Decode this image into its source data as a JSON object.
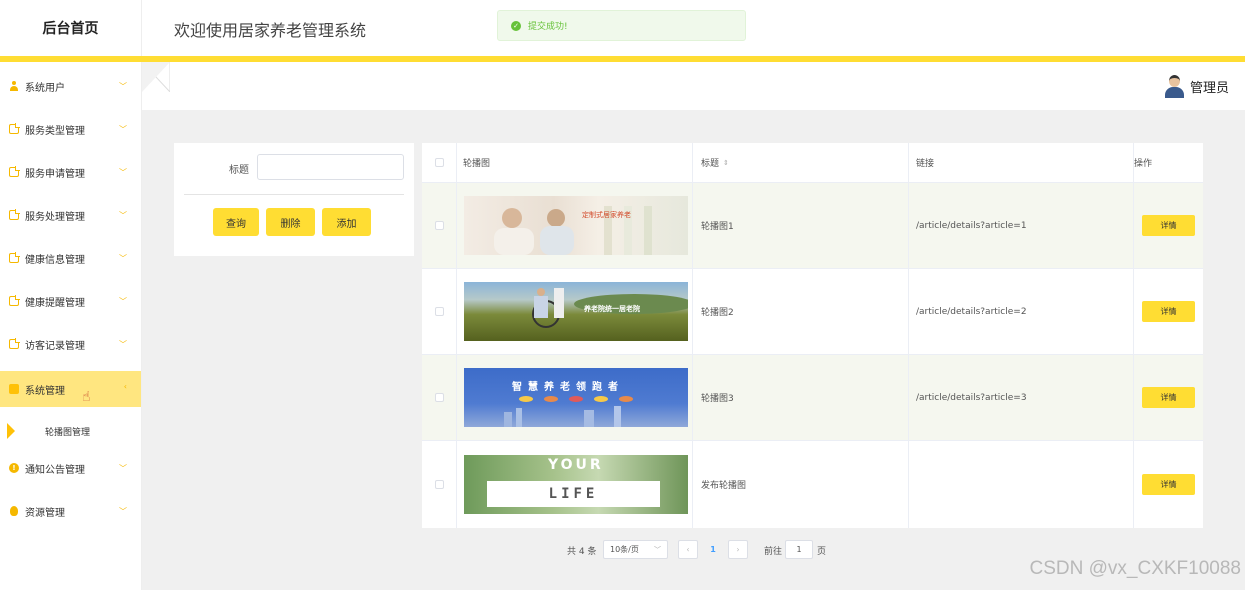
{
  "header": {
    "brand": "后台首页",
    "welcome": "欢迎使用居家养老管理系统",
    "toast": "提交成功!",
    "toast_icon": "check-circle-icon"
  },
  "user": {
    "name": "管理员",
    "avatar_icon": "avatar-icon"
  },
  "sidebar": {
    "items": [
      {
        "label": "系统用户",
        "icon": "user-icon"
      },
      {
        "label": "服务类型管理",
        "icon": "document-icon"
      },
      {
        "label": "服务申请管理",
        "icon": "document-icon"
      },
      {
        "label": "服务处理管理",
        "icon": "document-icon"
      },
      {
        "label": "健康信息管理",
        "icon": "document-icon"
      },
      {
        "label": "健康提醒管理",
        "icon": "document-icon"
      },
      {
        "label": "访客记录管理",
        "icon": "document-icon"
      },
      {
        "label": "系统管理",
        "icon": "system-icon",
        "expanded": true
      },
      {
        "label": "通知公告管理",
        "icon": "info-icon"
      },
      {
        "label": "资源管理",
        "icon": "bulb-icon"
      }
    ],
    "sub_item": "轮播图管理"
  },
  "search": {
    "label": "标题",
    "value": "",
    "buttons": {
      "query": "查询",
      "delete": "删除",
      "add": "添加"
    }
  },
  "table": {
    "headers": {
      "image": "轮播图",
      "title": "标题",
      "link": "链接",
      "action": "操作"
    },
    "rows": [
      {
        "title": "轮播图1",
        "link": "/article/details?article=1",
        "action": "详情",
        "banner_text": "定制式居家养老"
      },
      {
        "title": "轮播图2",
        "link": "/article/details?article=2",
        "action": "详情",
        "banner_text": "养老院统一居老院"
      },
      {
        "title": "轮播图3",
        "link": "/article/details?article=3",
        "action": "详情",
        "banner_text": "智慧养老领跑者"
      },
      {
        "title": "发布轮播图",
        "link": "",
        "action": "详情",
        "banner_text_top": "YOUR",
        "banner_text_bottom": "LIFE"
      }
    ]
  },
  "pagination": {
    "total": "共 4 条",
    "page_size": "10条/页",
    "current_page": "1",
    "goto_label": "前往",
    "goto_value": "1",
    "page_suffix": "页"
  },
  "watermark": "CSDN @vx_CXKF10088",
  "colors": {
    "accent": "#ffdd33",
    "success": "#67c23a",
    "row_alt": "#f5f7ef"
  }
}
